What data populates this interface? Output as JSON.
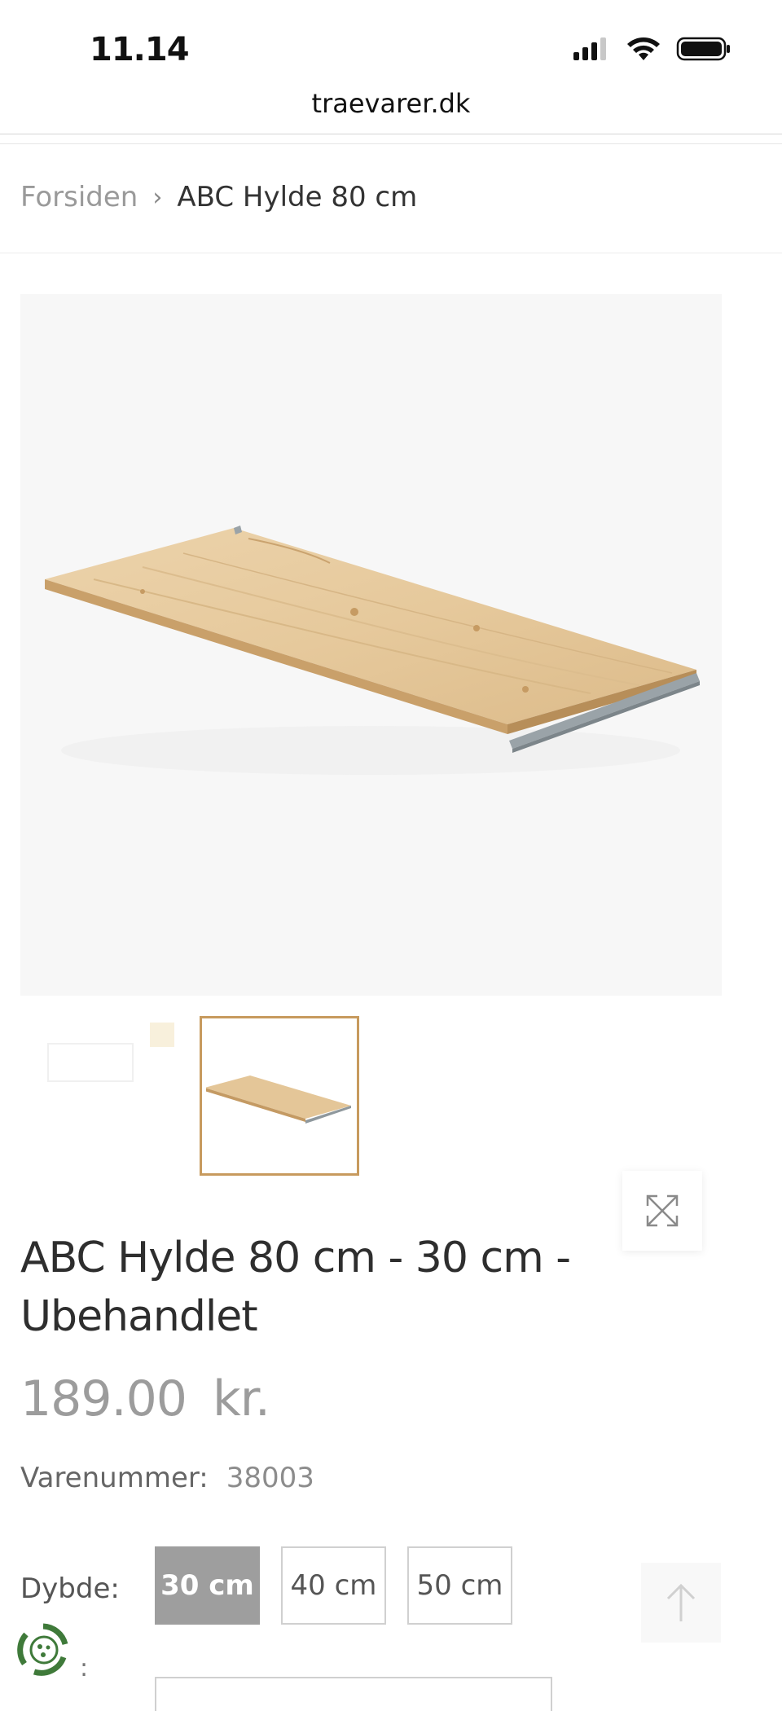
{
  "status_bar": {
    "time": "11.14",
    "signal_icon": "cellular-signal-icon",
    "wifi_icon": "wifi-icon",
    "battery_icon": "battery-icon"
  },
  "browser": {
    "url": "traevarer.dk"
  },
  "breadcrumb": {
    "home": "Forsiden",
    "separator": "›",
    "current": "ABC Hylde 80 cm"
  },
  "gallery": {
    "expand_icon": "expand-arrows-icon",
    "selected_thumbnail_index": 1
  },
  "product": {
    "title": "ABC Hylde 80 cm - 30 cm - Ubehandlet",
    "price_value": "189.00",
    "price_currency": "kr.",
    "sku_label": "Varenummer:",
    "sku_value": "38003"
  },
  "options": {
    "depth_label": "Dybde:",
    "values": [
      "30 cm",
      "40 cm",
      "50 cm"
    ],
    "selected": "30 cm",
    "second_label": ":"
  },
  "controls": {
    "scroll_top_icon": "arrow-up-icon",
    "eco_badge_icon": "eco-recycle-badge-icon"
  },
  "colors": {
    "accent": "#c79a5e",
    "selected_option_bg": "#9e9e9e",
    "price_color": "#9c9c9c"
  }
}
